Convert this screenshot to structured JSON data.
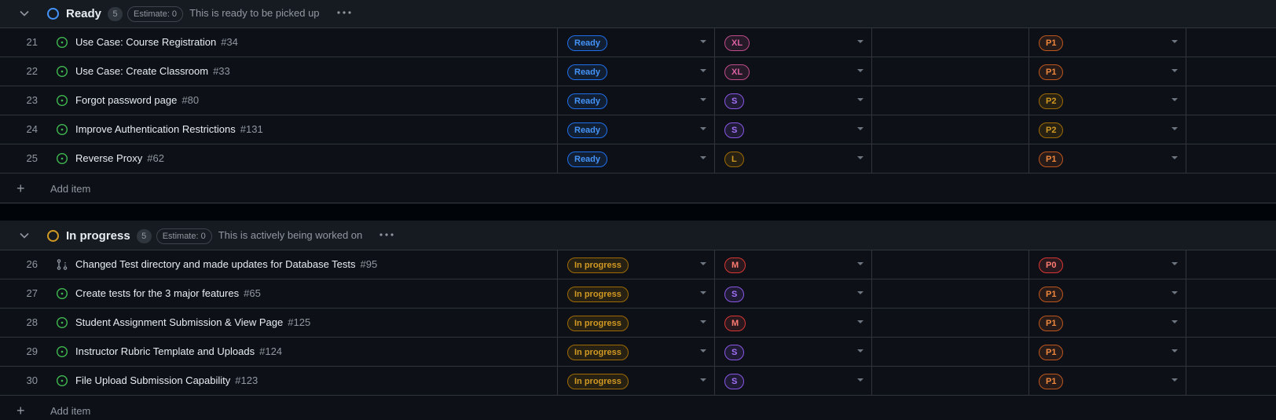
{
  "colors": {
    "ready_ring": "#4493f8",
    "in_progress_ring": "#d29922",
    "open_issue": "#3fb950"
  },
  "groups": [
    {
      "title": "Ready",
      "count": "5",
      "estimate": "Estimate: 0",
      "description": "This is ready to be picked up",
      "ring_color": "#4493f8",
      "add_label": "Add item",
      "rows": [
        {
          "num": "21",
          "title": "Use Case: Course Registration",
          "issue": "#34",
          "icon": "open-issue-icon",
          "status": "Ready",
          "size": "XL",
          "priority": "P1"
        },
        {
          "num": "22",
          "title": "Use Case: Create Classroom",
          "issue": "#33",
          "icon": "open-issue-icon",
          "status": "Ready",
          "size": "XL",
          "priority": "P1"
        },
        {
          "num": "23",
          "title": "Forgot password page",
          "issue": "#80",
          "icon": "open-issue-icon",
          "status": "Ready",
          "size": "S",
          "priority": "P2"
        },
        {
          "num": "24",
          "title": "Improve Authentication Restrictions",
          "issue": "#131",
          "icon": "open-issue-icon",
          "status": "Ready",
          "size": "S",
          "priority": "P2"
        },
        {
          "num": "25",
          "title": "Reverse Proxy",
          "issue": "#62",
          "icon": "open-issue-icon",
          "status": "Ready",
          "size": "L",
          "priority": "P1"
        }
      ]
    },
    {
      "title": "In progress",
      "count": "5",
      "estimate": "Estimate: 0",
      "description": "This is actively being worked on",
      "ring_color": "#d29922",
      "add_label": "Add item",
      "rows": [
        {
          "num": "26",
          "title": "Changed Test directory and made updates for Database Tests",
          "issue": "#95",
          "icon": "pull-request-icon",
          "status": "In progress",
          "size": "M",
          "priority": "P0"
        },
        {
          "num": "27",
          "title": "Create tests for the 3 major features",
          "issue": "#65",
          "icon": "open-issue-icon",
          "status": "In progress",
          "size": "S",
          "priority": "P1"
        },
        {
          "num": "28",
          "title": "Student Assignment Submission & View Page",
          "issue": "#125",
          "icon": "open-issue-icon",
          "status": "In progress",
          "size": "M",
          "priority": "P1"
        },
        {
          "num": "29",
          "title": "Instructor Rubric Template and Uploads",
          "issue": "#124",
          "icon": "open-issue-icon",
          "status": "In progress",
          "size": "S",
          "priority": "P1"
        },
        {
          "num": "30",
          "title": "File Upload Submission Capability",
          "issue": "#123",
          "icon": "open-issue-icon",
          "status": "In progress",
          "size": "S",
          "priority": "P1"
        }
      ]
    }
  ]
}
